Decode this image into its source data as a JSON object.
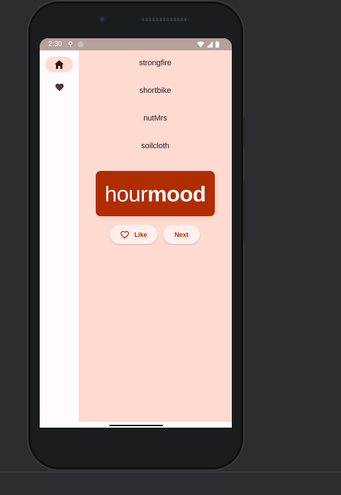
{
  "device": {
    "status_bar": {
      "time": "2:30",
      "icons": [
        "usb-icon",
        "wireless-debug-icon",
        "wifi-icon",
        "signal-icon",
        "battery-icon"
      ]
    }
  },
  "navigation_rail": {
    "items": [
      {
        "name": "home",
        "icon": "home-icon",
        "selected": true
      },
      {
        "name": "favorites",
        "icon": "heart-icon",
        "selected": false
      }
    ]
  },
  "favorites_list": {
    "items": [
      "strongfire",
      "shortbike",
      "nutMrs",
      "soilcloth"
    ]
  },
  "word_card": {
    "first": "hour",
    "second": "mood"
  },
  "actions": {
    "like_label": "Like",
    "next_label": "Next"
  },
  "colors": {
    "primary": "#b02d00",
    "content_background": "#ffdad1",
    "rail_background": "#fffbff",
    "rail_indicator": "#ffdbd0",
    "button_background": "#fff0ec",
    "status_bar": "#b6a19b"
  }
}
